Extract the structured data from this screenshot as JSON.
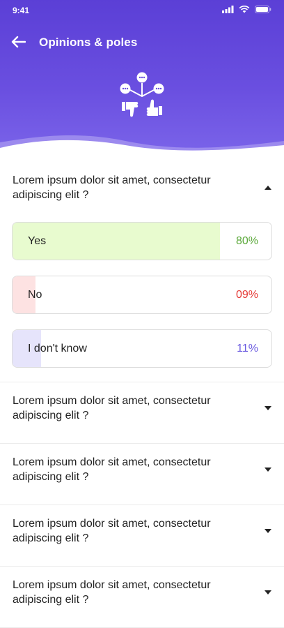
{
  "status_bar": {
    "time": "9:41"
  },
  "appbar": {
    "title": "Opinions & poles"
  },
  "questions": [
    {
      "text": "Lorem ipsum dolor sit amet, consectetur adipiscing elit ?",
      "expanded": true,
      "options": [
        {
          "label": "Yes",
          "percent_text": "80%",
          "percent": 80,
          "fill_color": "#e8fbcf",
          "text_color": "#5aa839"
        },
        {
          "label": "No",
          "percent_text": "09%",
          "percent": 9,
          "fill_color": "#fde2e2",
          "text_color": "#e53935"
        },
        {
          "label": "I don't know",
          "percent_text": "11%",
          "percent": 11,
          "fill_color": "#e6e4fb",
          "text_color": "#6a5ae0"
        }
      ]
    },
    {
      "text": "Lorem ipsum dolor sit amet, consectetur adipiscing elit ?",
      "expanded": false
    },
    {
      "text": "Lorem ipsum dolor sit amet, consectetur adipiscing elit ?",
      "expanded": false
    },
    {
      "text": "Lorem ipsum dolor sit amet, consectetur adipiscing elit ?",
      "expanded": false
    },
    {
      "text": "Lorem ipsum dolor sit amet, consectetur adipiscing elit ?",
      "expanded": false
    }
  ],
  "icons": {
    "back": "arrow-left-icon",
    "hero": "opinions-poll-icon",
    "expanded": "chevron-up-icon",
    "collapsed": "chevron-down-icon"
  },
  "colors": {
    "header_top": "#5b3fd6",
    "header_bottom": "#7c66ea"
  }
}
